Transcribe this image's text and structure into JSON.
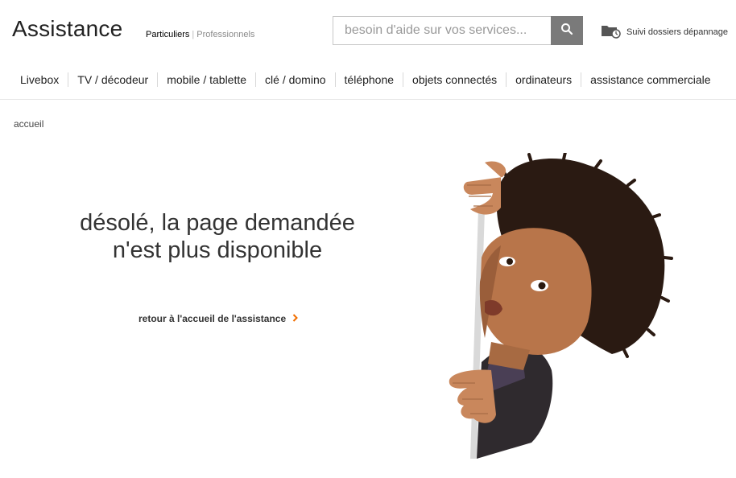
{
  "header": {
    "brand": "Assistance",
    "segments": {
      "active": "Particuliers",
      "separator": "|",
      "inactive": "Professionnels"
    },
    "search": {
      "placeholder": "besoin d'aide sur vos services...",
      "value": ""
    },
    "tracker_label": "Suivi dossiers dépannage"
  },
  "nav": {
    "items": [
      "Livebox",
      "TV / décodeur",
      "mobile / tablette",
      "clé / domino",
      "téléphone",
      "objets connectés",
      "ordinateurs",
      "assistance commerciale"
    ]
  },
  "breadcrumb": {
    "home": "accueil"
  },
  "main": {
    "title_line1": "désolé, la page demandée",
    "title_line2": "n'est plus disponible",
    "back_link": "retour à l'accueil de l'assistance"
  },
  "colors": {
    "accent": "#f16e00",
    "search_button": "#7a7a7a",
    "text": "#333333"
  },
  "icons": {
    "search": "search-icon",
    "tracker": "folder-clock-icon",
    "link": "chevron-right-icon"
  }
}
